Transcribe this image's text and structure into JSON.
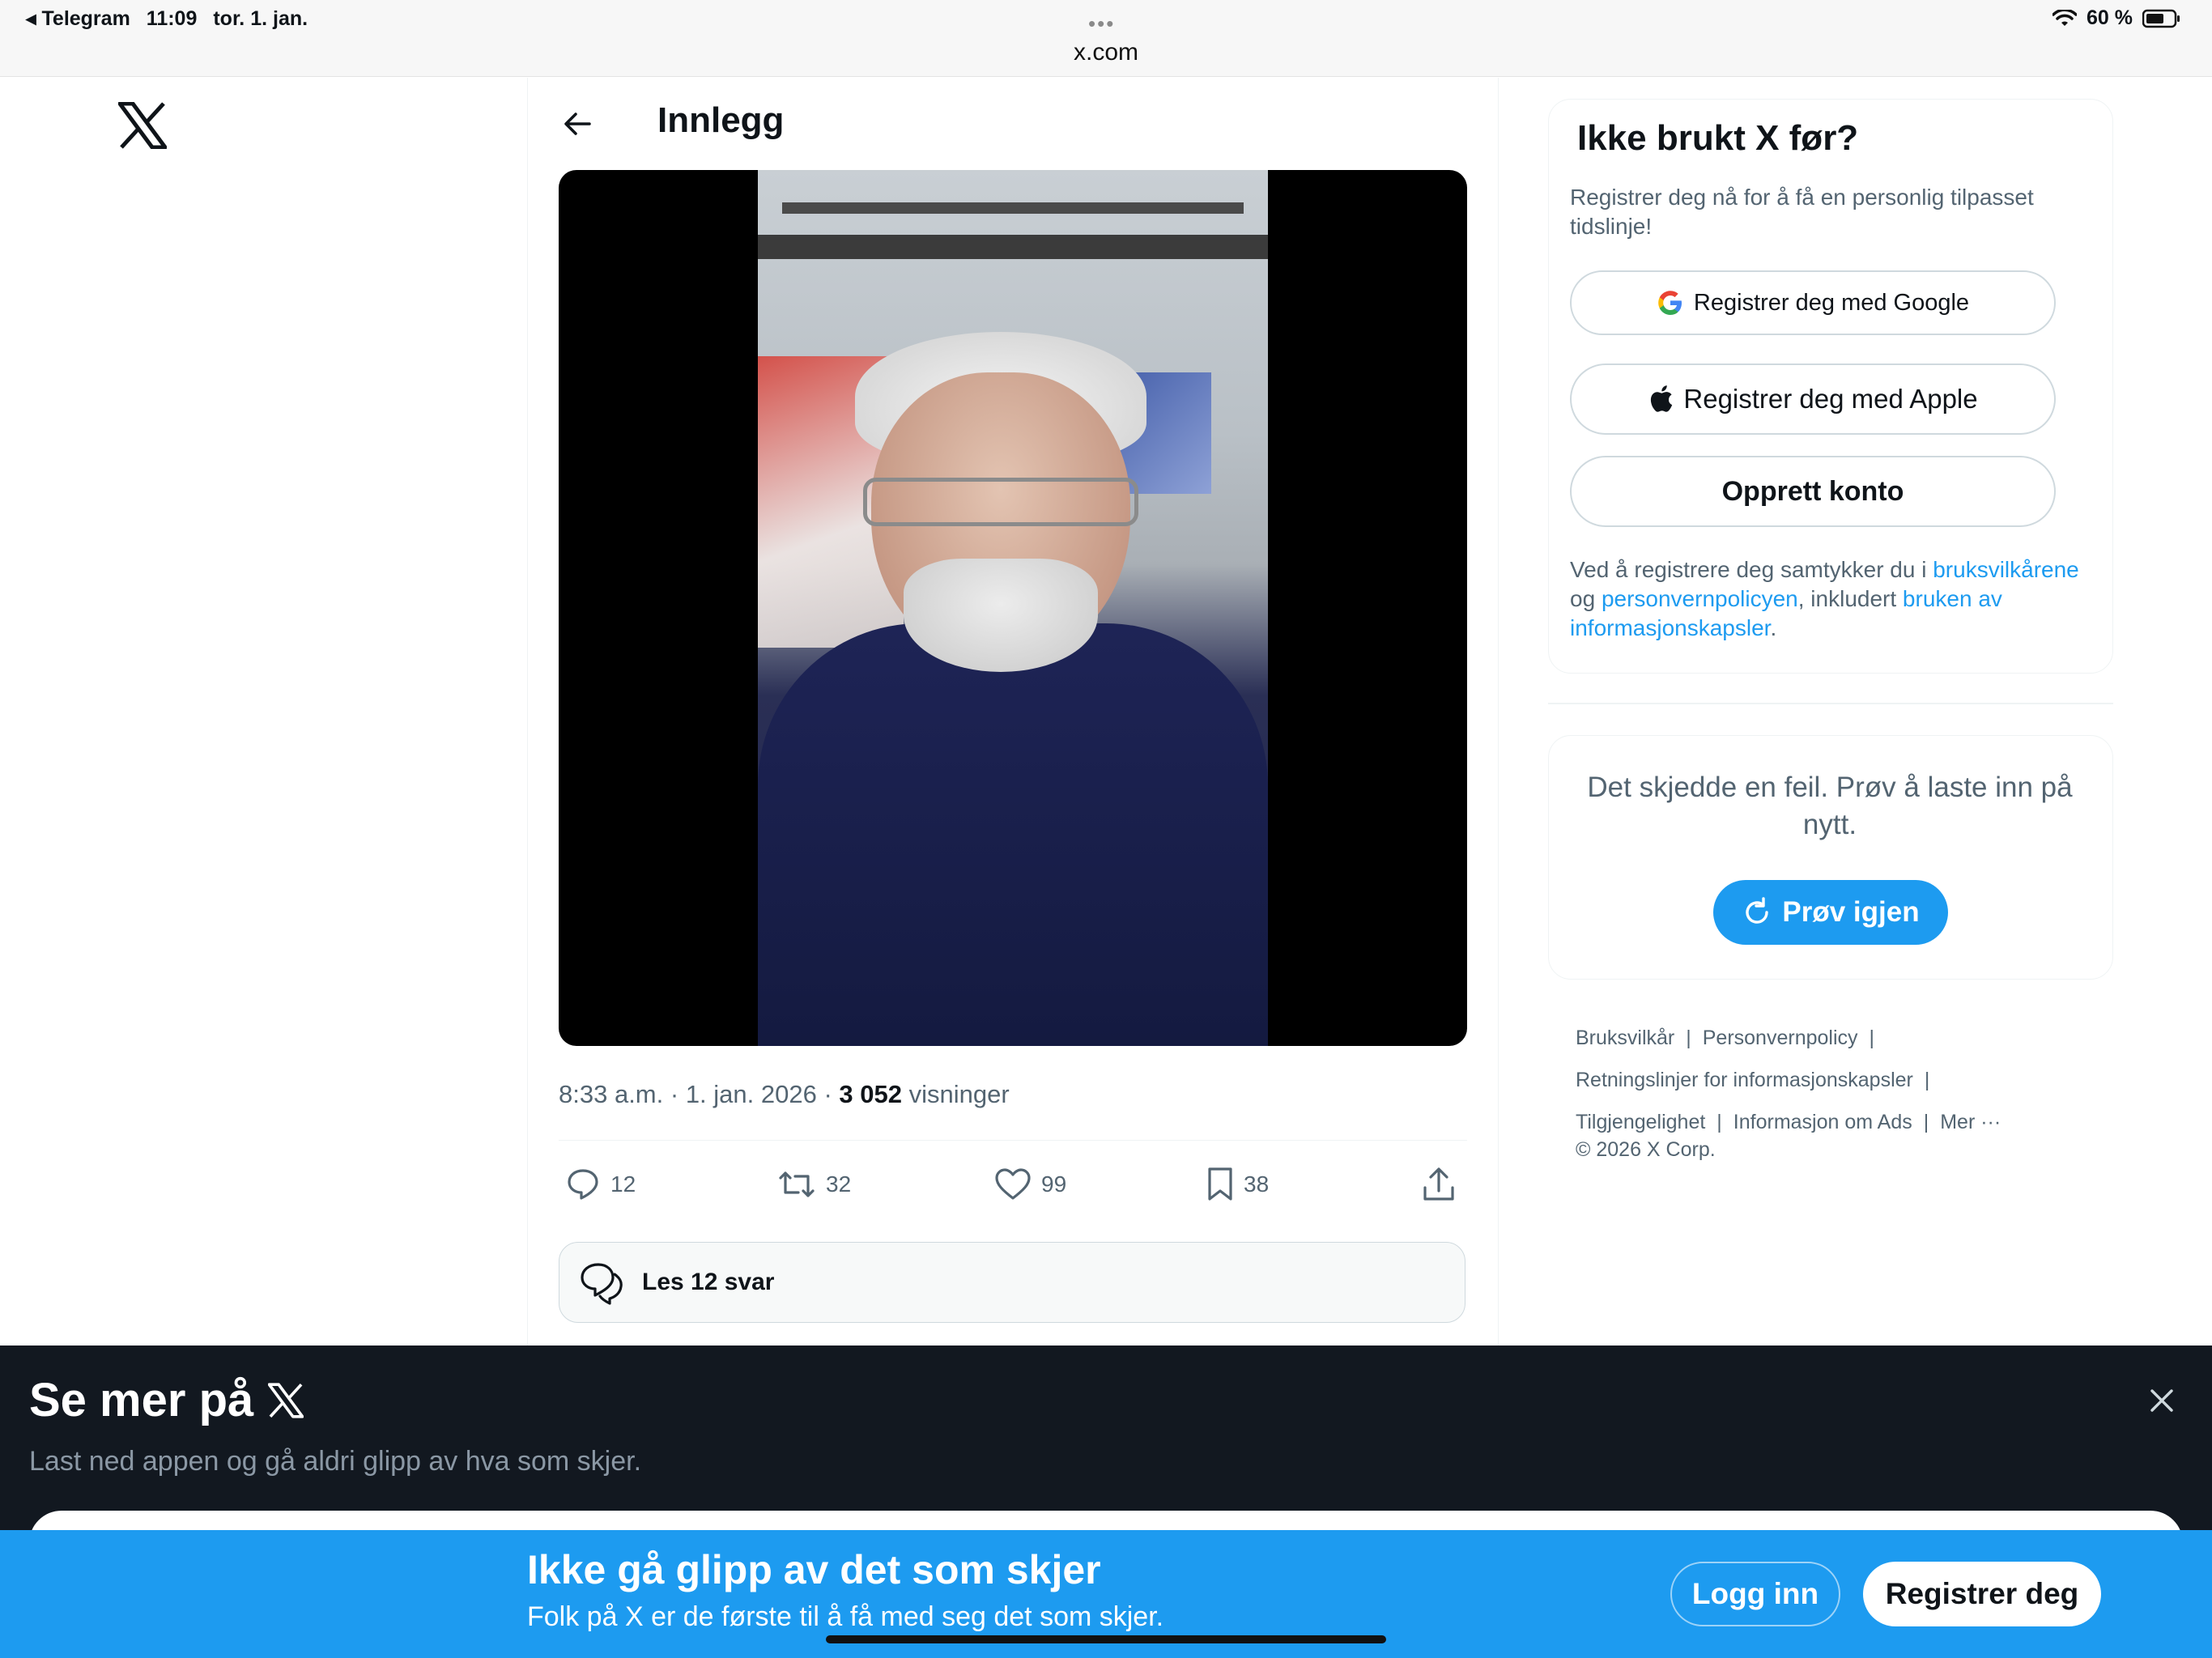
{
  "status_bar": {
    "back_app": "◂ Telegram",
    "time": "11:09",
    "date": "tor. 1. jan.",
    "battery": "60 %",
    "url": "x.com",
    "dots": "•••"
  },
  "header": {
    "title": "Innlegg"
  },
  "post": {
    "time": "8:33 a.m.",
    "date": "1. jan. 2026",
    "views_count": "3 052",
    "views_label": "visninger",
    "replies": "12",
    "reposts": "32",
    "likes": "99",
    "bookmarks": "38",
    "read_replies": "Les 12 svar"
  },
  "signup_card": {
    "title": "Ikke brukt X før?",
    "subtitle": "Registrer deg nå for å få en personlig tilpasset tidslinje!",
    "google_label": "Registrer deg med Google",
    "apple_label": "Registrer deg med Apple",
    "create_label": "Opprett konto",
    "terms_pre": "Ved å registrere deg samtykker du i ",
    "terms_link1": "bruksvilkårene",
    "terms_mid1": " og ",
    "terms_link2": "personvernpolicyen",
    "terms_mid2": ", inkludert ",
    "terms_link3": "bruken av informasjonskapsler",
    "terms_post": "."
  },
  "error_card": {
    "message": "Det skjedde en feil. Prøv å laste inn på nytt.",
    "retry_label": "Prøv igjen"
  },
  "footer": {
    "links": [
      "Bruksvilkår",
      "Personvernpolicy",
      "Retningslinjer for informasjonskapsler",
      "Tilgjengelighet",
      "Informasjon om Ads",
      "Mer ···"
    ],
    "copyright": "© 2026 X Corp."
  },
  "overlay": {
    "title": "Se mer på",
    "subtitle": "Last ned appen og gå aldri glipp av hva som skjer."
  },
  "banner": {
    "title": "Ikke gå glipp av det som skjer",
    "subtitle": "Folk på X er de første til å få med seg det som skjer.",
    "login_label": "Logg inn",
    "register_label": "Registrer deg"
  },
  "colors": {
    "accent": "#1d9bf0",
    "text": "#0f1419",
    "muted": "#536471",
    "overlay_bg": "#121820"
  },
  "icons": [
    "x-logo-icon",
    "back-arrow-icon",
    "reply-icon",
    "repost-icon",
    "like-icon",
    "bookmark-icon",
    "share-icon",
    "chat-bubbles-icon",
    "google-icon",
    "apple-icon",
    "refresh-icon",
    "close-icon",
    "wifi-icon",
    "battery-icon"
  ]
}
